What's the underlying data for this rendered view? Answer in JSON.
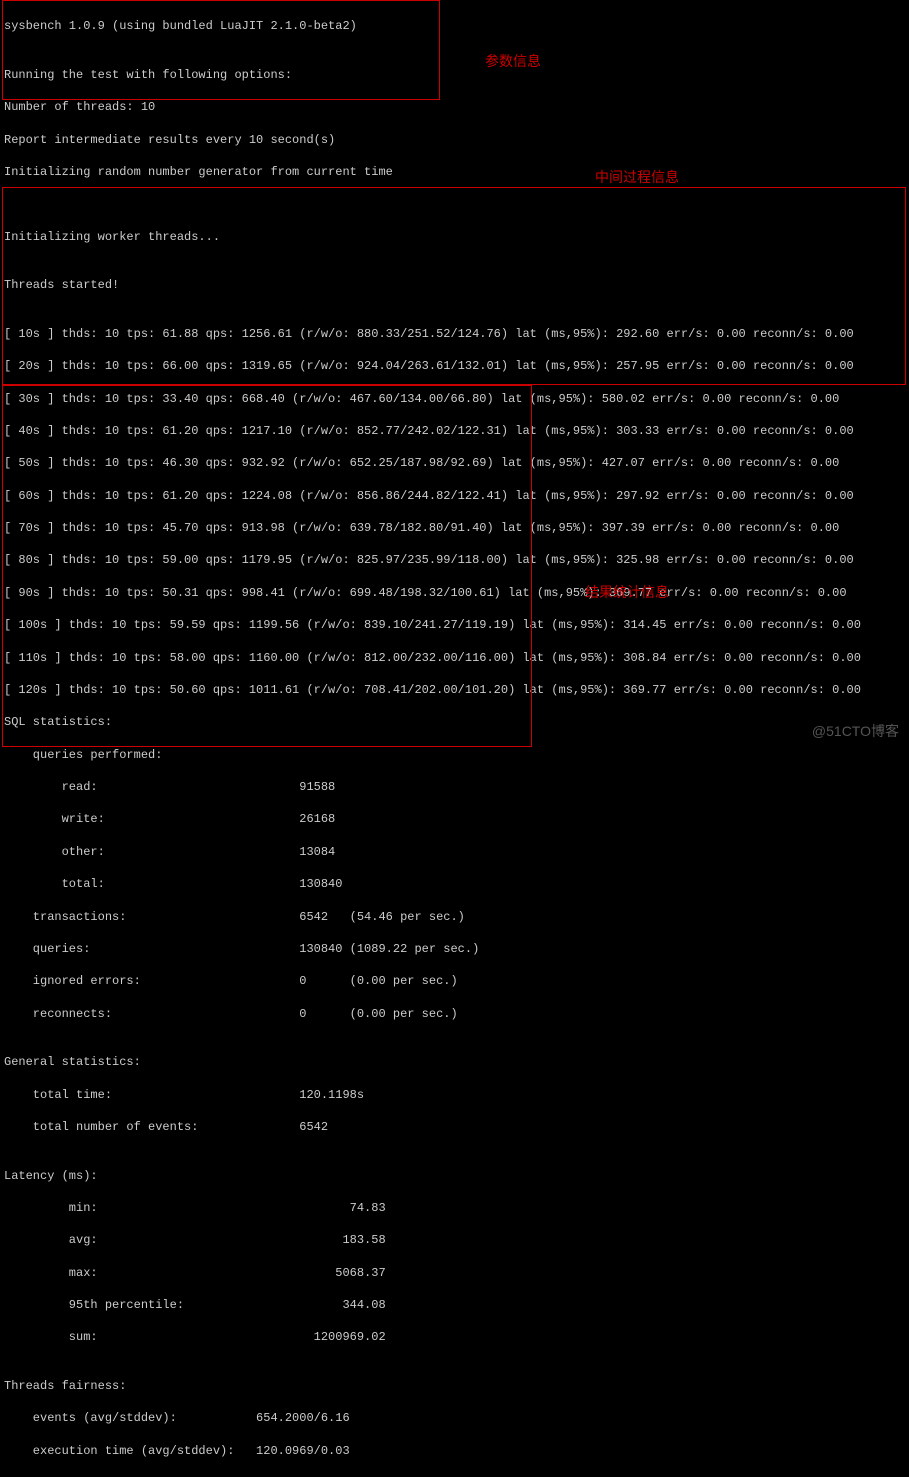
{
  "header": {
    "version_line": "sysbench 1.0.9 (using bundled LuaJIT 2.1.0-beta2)",
    "blank1": "",
    "options_header": "Running the test with following options:",
    "threads_line": "Number of threads: 10",
    "report_line": "Report intermediate results every 10 second(s)",
    "init_rng": "Initializing random number generator from current time",
    "blank2": "",
    "blank3": "",
    "init_threads": "Initializing worker threads...",
    "blank4": "",
    "threads_started": "Threads started!",
    "blank5": ""
  },
  "intermediate": [
    "[ 10s ] thds: 10 tps: 61.88 qps: 1256.61 (r/w/o: 880.33/251.52/124.76) lat (ms,95%): 292.60 err/s: 0.00 reconn/s: 0.00",
    "[ 20s ] thds: 10 tps: 66.00 qps: 1319.65 (r/w/o: 924.04/263.61/132.01) lat (ms,95%): 257.95 err/s: 0.00 reconn/s: 0.00",
    "[ 30s ] thds: 10 tps: 33.40 qps: 668.40 (r/w/o: 467.60/134.00/66.80) lat (ms,95%): 580.02 err/s: 0.00 reconn/s: 0.00",
    "[ 40s ] thds: 10 tps: 61.20 qps: 1217.10 (r/w/o: 852.77/242.02/122.31) lat (ms,95%): 303.33 err/s: 0.00 reconn/s: 0.00",
    "[ 50s ] thds: 10 tps: 46.30 qps: 932.92 (r/w/o: 652.25/187.98/92.69) lat (ms,95%): 427.07 err/s: 0.00 reconn/s: 0.00",
    "[ 60s ] thds: 10 tps: 61.20 qps: 1224.08 (r/w/o: 856.86/244.82/122.41) lat (ms,95%): 297.92 err/s: 0.00 reconn/s: 0.00",
    "[ 70s ] thds: 10 tps: 45.70 qps: 913.98 (r/w/o: 639.78/182.80/91.40) lat (ms,95%): 397.39 err/s: 0.00 reconn/s: 0.00",
    "[ 80s ] thds: 10 tps: 59.00 qps: 1179.95 (r/w/o: 825.97/235.99/118.00) lat (ms,95%): 325.98 err/s: 0.00 reconn/s: 0.00",
    "[ 90s ] thds: 10 tps: 50.31 qps: 998.41 (r/w/o: 699.48/198.32/100.61) lat (ms,95%): 369.77 err/s: 0.00 reconn/s: 0.00",
    "[ 100s ] thds: 10 tps: 59.59 qps: 1199.56 (r/w/o: 839.10/241.27/119.19) lat (ms,95%): 314.45 err/s: 0.00 reconn/s: 0.00",
    "[ 110s ] thds: 10 tps: 58.00 qps: 1160.00 (r/w/o: 812.00/232.00/116.00) lat (ms,95%): 308.84 err/s: 0.00 reconn/s: 0.00",
    "[ 120s ] thds: 10 tps: 50.60 qps: 1011.61 (r/w/o: 708.41/202.00/101.20) lat (ms,95%): 369.77 err/s: 0.00 reconn/s: 0.00"
  ],
  "stats": {
    "sql_header": "SQL statistics:",
    "queries_performed": "    queries performed:",
    "read": "        read:                            91588",
    "write": "        write:                           26168",
    "other": "        other:                           13084",
    "total": "        total:                           130840",
    "transactions": "    transactions:                        6542   (54.46 per sec.)",
    "queries": "    queries:                             130840 (1089.22 per sec.)",
    "ignored": "    ignored errors:                      0      (0.00 per sec.)",
    "reconnects": "    reconnects:                          0      (0.00 per sec.)",
    "blank1": "",
    "gen_header": "General statistics:",
    "total_time": "    total time:                          120.1198s",
    "total_events": "    total number of events:              6542",
    "blank2": "",
    "lat_header": "Latency (ms):",
    "lat_min": "         min:                                   74.83",
    "lat_avg": "         avg:                                  183.58",
    "lat_max": "         max:                                 5068.37",
    "lat_95": "         95th percentile:                      344.08",
    "lat_sum": "         sum:                              1200969.02",
    "blank3": "",
    "fairness_header": "Threads fairness:",
    "events_fair": "    events (avg/stddev):           654.2000/6.16",
    "exec_fair": "    execution time (avg/stddev):   120.0969/0.03"
  },
  "annotations": {
    "params": "参数信息",
    "intermediate": "中间过程信息",
    "results": "结果统计信息"
  },
  "watermark": "@51CTO博客"
}
